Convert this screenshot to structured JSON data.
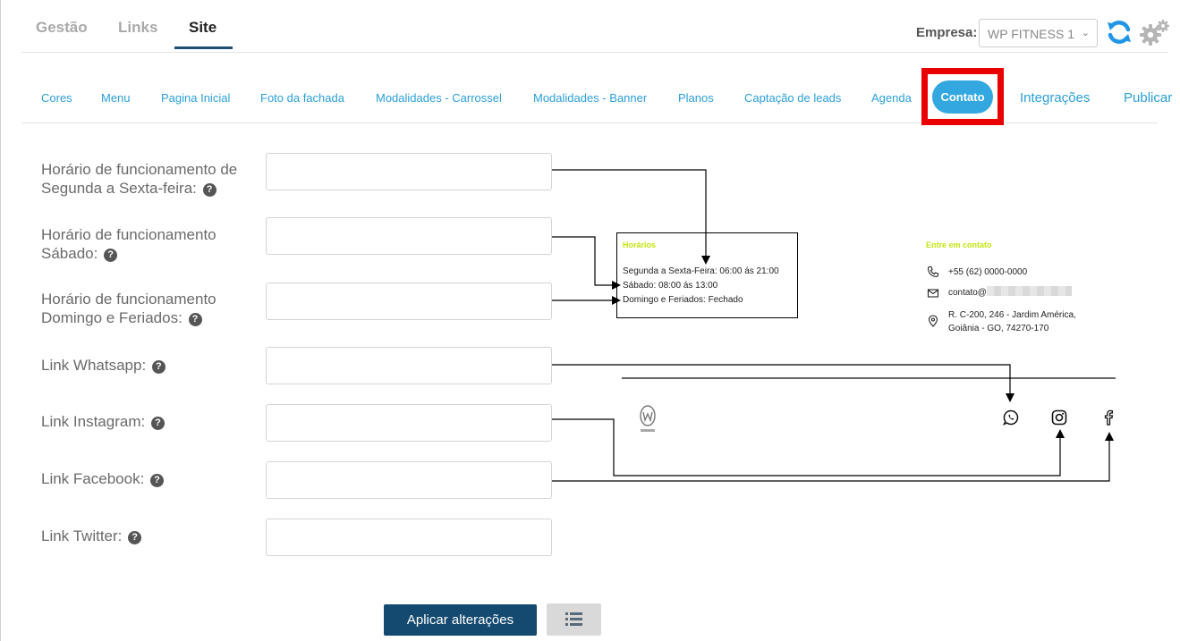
{
  "top_tabs": [
    "Gestão",
    "Links",
    "Site"
  ],
  "empresa": {
    "label": "Empresa:",
    "selected": "WP FITNESS 1"
  },
  "sub_tabs": [
    "Cores",
    "Menu",
    "Pagina Inicial",
    "Foto da fachada",
    "Modalidades - Carrossel",
    "Modalidades - Banner",
    "Planos",
    "Captação de leads",
    "Agenda",
    "Contato",
    "Integrações",
    "Publicar"
  ],
  "active_sub_tab": "Contato",
  "form": {
    "fields": [
      {
        "label_line1": "Horário de funcionamento de",
        "label_line2": "Segunda a Sexta-feira:",
        "value": ""
      },
      {
        "label_line1": "Horário de funcionamento",
        "label_line2": "Sábado:",
        "value": ""
      },
      {
        "label_line1": "Horário de funcionamento",
        "label_line2": "Domingo e Feriados:",
        "value": ""
      },
      {
        "label_line1": "Link Whatsapp:",
        "value": ""
      },
      {
        "label_line1": "Link Instagram:",
        "value": ""
      },
      {
        "label_line1": "Link Facebook:",
        "value": ""
      },
      {
        "label_line1": "Link Twitter:",
        "value": ""
      }
    ],
    "help_glyph": "?"
  },
  "preview": {
    "hours_title": "Horários",
    "hours_lines": [
      "Segunda a Sexta-Feira: 06:00 ás 21:00",
      "Sábado: 08:00 ás 13:00",
      "Domingo e Feriados: Fechado"
    ],
    "contact_title": "Entre em contato",
    "phone": "+55 (62) 0000-0000",
    "email_prefix": "contato@",
    "address_line1": "R. C-200, 246 - Jardim América,",
    "address_line2": "Goiânia - GO, 74270-170",
    "accent_color": "#c4e50e",
    "icons": [
      "phone-icon",
      "mail-icon",
      "location-pin-icon",
      "whatsapp-icon",
      "instagram-icon",
      "facebook-icon"
    ]
  },
  "buttons": {
    "apply": "Aplicar alterações",
    "list_icon": "list-icon"
  },
  "colors": {
    "primary": "#144a6f",
    "link": "#2a9fd8",
    "pill": "#33a8e0",
    "highlight": "#ea0000"
  }
}
